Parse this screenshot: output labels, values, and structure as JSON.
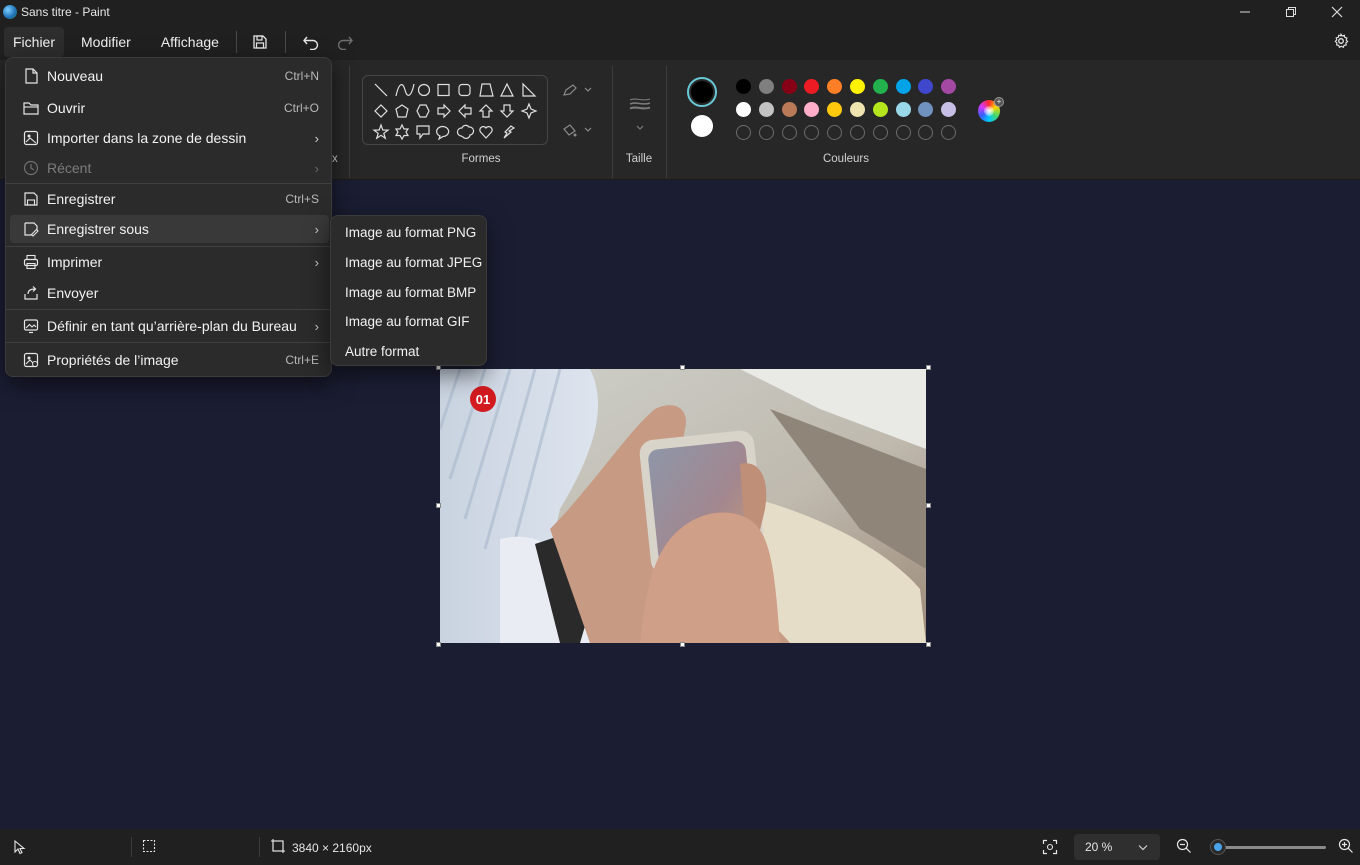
{
  "window": {
    "title": "Sans titre - Paint",
    "controls": [
      "minimize-icon",
      "restore-icon",
      "close-icon"
    ]
  },
  "menubar": {
    "items": [
      {
        "label": "Fichier",
        "active": true
      },
      {
        "label": "Modifier",
        "active": false
      },
      {
        "label": "Affichage",
        "active": false
      }
    ],
    "icons": [
      "save-icon",
      "undo-icon",
      "redo-icon",
      "gear-icon"
    ]
  },
  "ribbon": {
    "groups": {
      "shapes": "Formes",
      "size": "Taille",
      "colors": "Couleurs",
      "partial_label": "x"
    },
    "primary_color": "#000000",
    "secondary_color": "#ffffff",
    "palette_row1": [
      "#000000",
      "#7f7f7f",
      "#880015",
      "#ed1c24",
      "#ff7f27",
      "#fff200",
      "#22b14c",
      "#00a2e8",
      "#3f48cc",
      "#a349a4"
    ],
    "palette_row2": [
      "#ffffff",
      "#c3c3c3",
      "#b97a57",
      "#ffaec9",
      "#ffc90e",
      "#efe4b0",
      "#b5e61d",
      "#99d9ea",
      "#7092be",
      "#c8bfe7"
    ],
    "custom_slots": 10
  },
  "file_menu": {
    "items": [
      {
        "label": "Nouveau",
        "shortcut": "Ctrl+N",
        "icon": "new-file-icon"
      },
      {
        "label": "Ouvrir",
        "shortcut": "Ctrl+O",
        "icon": "folder-icon"
      },
      {
        "label": "Importer dans la zone de dessin",
        "shortcut": "",
        "icon": "import-image-icon",
        "submenu": true
      },
      {
        "label": "Récent",
        "shortcut": "",
        "icon": "clock-icon",
        "submenu": true,
        "disabled": true
      },
      {
        "label": "Enregistrer",
        "shortcut": "Ctrl+S",
        "icon": "save-icon"
      },
      {
        "label": "Enregistrer sous",
        "shortcut": "",
        "icon": "save-as-icon",
        "submenu": true,
        "highlighted": true
      },
      {
        "label": "Imprimer",
        "shortcut": "",
        "icon": "printer-icon",
        "submenu": true
      },
      {
        "label": "Envoyer",
        "shortcut": "",
        "icon": "share-icon"
      },
      {
        "label": "Définir en tant qu’arrière-plan du Bureau",
        "shortcut": "",
        "icon": "wallpaper-icon",
        "submenu": true
      },
      {
        "label": "Propriétés de l’image",
        "shortcut": "Ctrl+E",
        "icon": "image-properties-icon"
      }
    ]
  },
  "save_as_submenu": {
    "items": [
      "Image au format PNG",
      "Image au format JPEG",
      "Image au format BMP",
      "Image au format GIF",
      "Autre format"
    ]
  },
  "canvas": {
    "image_badge": "01"
  },
  "statusbar": {
    "dimensions": "3840 × 2160px",
    "zoom": "20 %",
    "zoom_level": 0.05,
    "icons": [
      "pointer-icon",
      "selection-icon",
      "canvas-size-icon",
      "fit-to-window-icon",
      "zoom-out-icon",
      "zoom-in-icon"
    ]
  }
}
